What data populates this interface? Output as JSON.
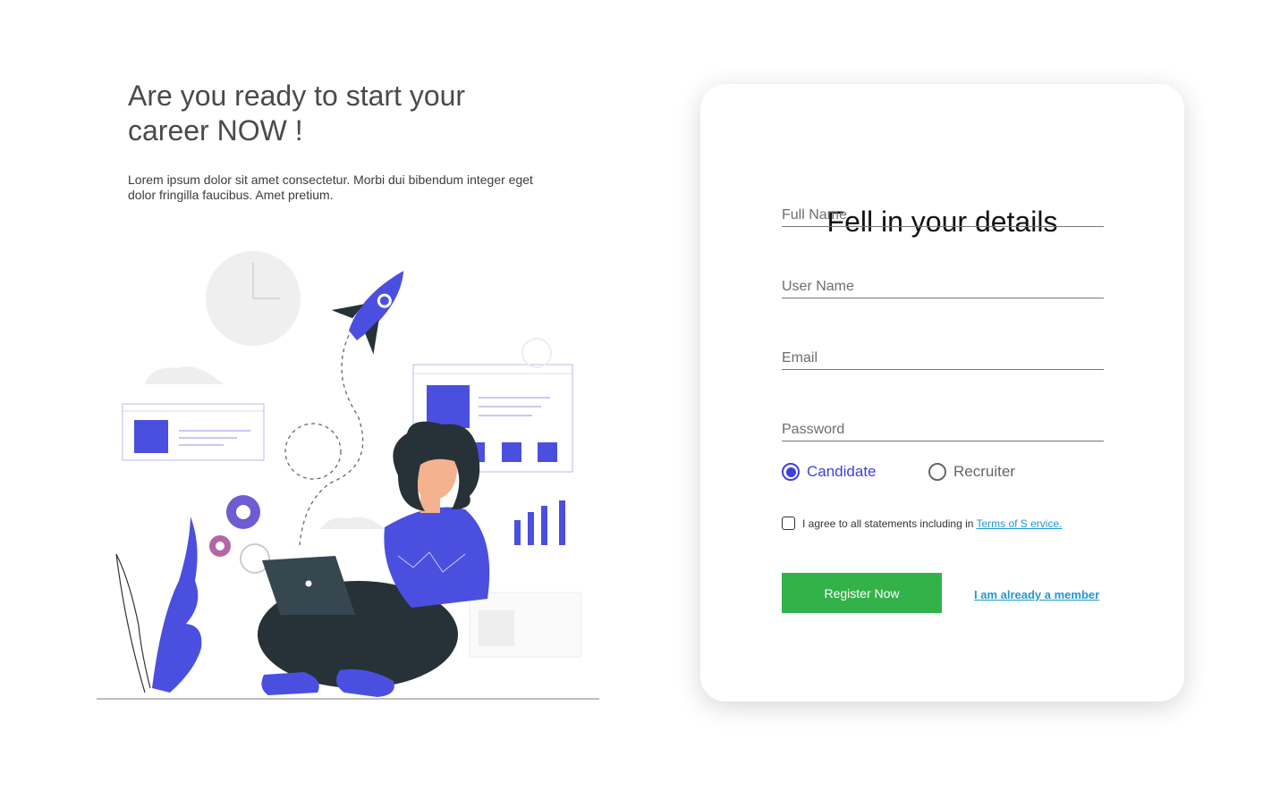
{
  "hero": {
    "title": "Are you ready to start your career NOW !",
    "description": "Lorem ipsum dolor sit amet consectetur. Morbi dui bibendum integer eget dolor fringilla faucibus. Amet pretium."
  },
  "illustration": {
    "name": "woman-working-on-laptop-illustration",
    "accent": "#4b4fe0"
  },
  "form": {
    "title": "Fell in your details",
    "fields": {
      "full_name": "Full Name",
      "user_name": "User Name",
      "email": "Email",
      "password": "Password"
    },
    "roles": {
      "candidate": "Candidate",
      "recruiter": "Recruiter",
      "selected": "Candidate"
    },
    "agreement": {
      "text": "I agree to all statements including in",
      "link": "Terms of S ervice.",
      "checked": false
    },
    "register_label": "Register Now",
    "member_link": "I am already a member"
  },
  "colors": {
    "accent": "#3d3fe0",
    "register": "#34b24a",
    "link": "#2196d8"
  }
}
